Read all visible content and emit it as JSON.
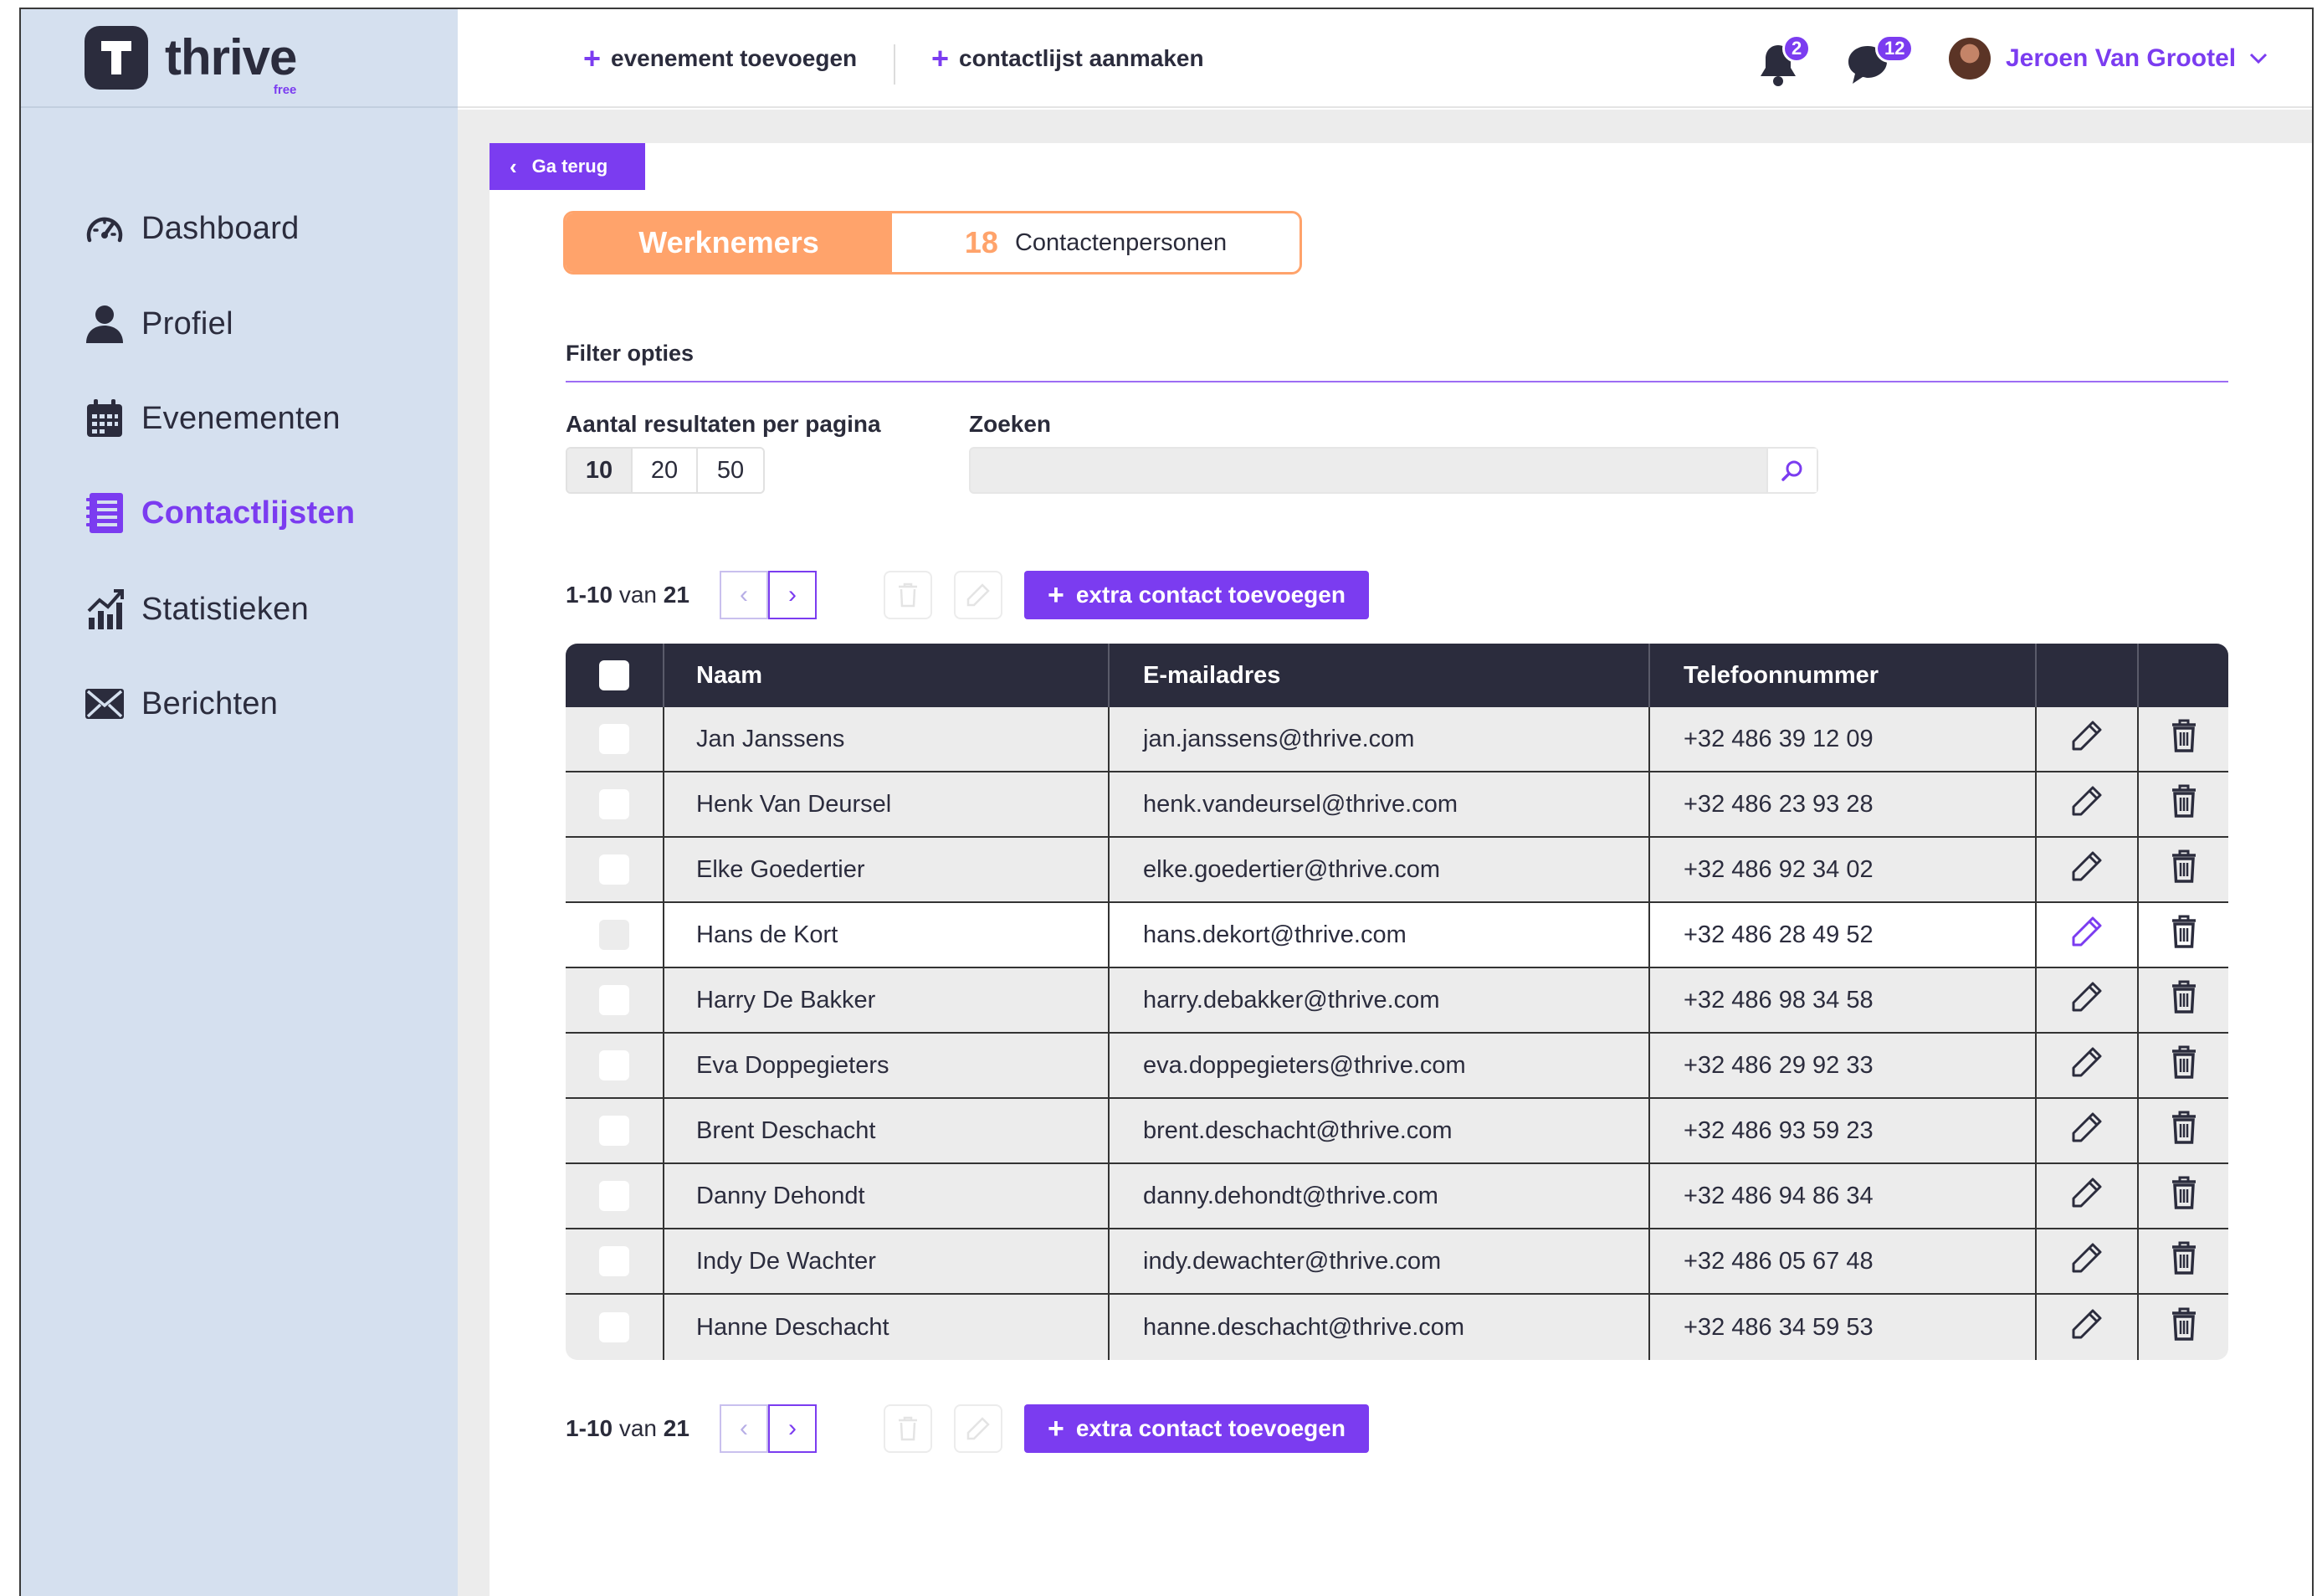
{
  "brand": {
    "name": "thrive",
    "tier": "free"
  },
  "sidebar": {
    "items": [
      {
        "label": "Dashboard",
        "icon": "speedometer-icon"
      },
      {
        "label": "Profiel",
        "icon": "user-icon"
      },
      {
        "label": "Evenementen",
        "icon": "calendar-icon"
      },
      {
        "label": "Contactlijsten",
        "icon": "list-icon",
        "active": true
      },
      {
        "label": "Statistieken",
        "icon": "chart-icon"
      },
      {
        "label": "Berichten",
        "icon": "envelope-icon"
      }
    ]
  },
  "topbar": {
    "add_event": "evenement toevoegen",
    "create_list": "contactlijst aanmaken",
    "notifications_count": "2",
    "messages_count": "12",
    "user_name": "Jeroen Van Grootel"
  },
  "back_button": "Ga terug",
  "toggle": {
    "active_label": "Werknemers",
    "count": "18",
    "other_label": "Contactenpersonen"
  },
  "filter": {
    "title": "Filter opties",
    "per_page_label": "Aantal resultaten per pagina",
    "per_page_options": [
      "10",
      "20",
      "50"
    ],
    "per_page_selected": "10",
    "search_label": "Zoeken",
    "search_value": ""
  },
  "pagination": {
    "range": "1-10",
    "of": "van",
    "total": "21"
  },
  "add_contact_label": "extra contact toevoegen",
  "table": {
    "headers": [
      "Naam",
      "E-mailadres",
      "Telefoonnummer"
    ],
    "rows": [
      {
        "name": "Jan Janssens",
        "email": "jan.janssens@thrive.com",
        "phone": "+32 486 39 12 09"
      },
      {
        "name": "Henk Van Deursel",
        "email": "henk.vandeursel@thrive.com",
        "phone": "+32 486 23 93 28"
      },
      {
        "name": "Elke Goedertier",
        "email": "elke.goedertier@thrive.com",
        "phone": "+32 486 92 34 02"
      },
      {
        "name": "Hans de Kort",
        "email": "hans.dekort@thrive.com",
        "phone": "+32 486 28 49 52"
      },
      {
        "name": "Harry De Bakker",
        "email": "harry.debakker@thrive.com",
        "phone": "+32 486 98 34 58"
      },
      {
        "name": "Eva Doppegieters",
        "email": "eva.doppegieters@thrive.com",
        "phone": "+32 486 29 92 33"
      },
      {
        "name": "Brent Deschacht",
        "email": "brent.deschacht@thrive.com",
        "phone": "+32 486 93 59 23"
      },
      {
        "name": "Danny Dehondt",
        "email": "danny.dehondt@thrive.com",
        "phone": "+32 486 94 86 34"
      },
      {
        "name": "Indy De Wachter",
        "email": "indy.dewachter@thrive.com",
        "phone": "+32 486 05 67 48"
      },
      {
        "name": "Hanne Deschacht",
        "email": "hanne.deschacht@thrive.com",
        "phone": "+32 486 34 59 53"
      }
    ]
  },
  "colors": {
    "accent": "#7b3cf0",
    "orange": "#ffa36b",
    "dark": "#2b2c3d",
    "sidebar": "#d5e0ef"
  }
}
